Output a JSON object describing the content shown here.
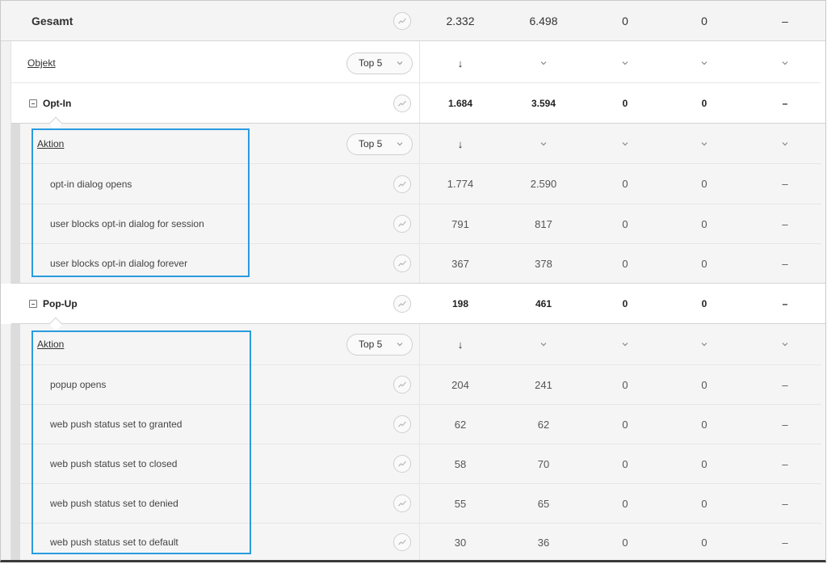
{
  "total": {
    "label": "Gesamt",
    "values": [
      "2.332",
      "6.498",
      "0",
      "0",
      "–"
    ]
  },
  "objekt": {
    "label": "Objekt",
    "top_label": "Top 5",
    "sort_arrow": "↓"
  },
  "groups": [
    {
      "title": "Opt-In",
      "values": [
        "1.684",
        "3.594",
        "0",
        "0",
        "–"
      ],
      "dimension": "Aktion",
      "top_label": "Top 5",
      "rows": [
        {
          "label": "opt-in dialog opens",
          "values": [
            "1.774",
            "2.590",
            "0",
            "0",
            "–"
          ]
        },
        {
          "label": "user blocks opt-in dialog for session",
          "values": [
            "791",
            "817",
            "0",
            "0",
            "–"
          ]
        },
        {
          "label": "user blocks opt-in dialog forever",
          "values": [
            "367",
            "378",
            "0",
            "0",
            "–"
          ]
        }
      ]
    },
    {
      "title": "Pop-Up",
      "values": [
        "198",
        "461",
        "0",
        "0",
        "–"
      ],
      "dimension": "Aktion",
      "top_label": "Top 5",
      "rows": [
        {
          "label": "popup opens",
          "values": [
            "204",
            "241",
            "0",
            "0",
            "–"
          ]
        },
        {
          "label": "web push status set to granted",
          "values": [
            "62",
            "62",
            "0",
            "0",
            "–"
          ]
        },
        {
          "label": "web push status set to closed",
          "values": [
            "58",
            "70",
            "0",
            "0",
            "–"
          ]
        },
        {
          "label": "web push status set to denied",
          "values": [
            "55",
            "65",
            "0",
            "0",
            "–"
          ]
        },
        {
          "label": "web push status set to default",
          "values": [
            "30",
            "36",
            "0",
            "0",
            "–"
          ]
        }
      ]
    }
  ],
  "icons": {
    "trend": "trend-line-icon",
    "chevron": "chevron-down-icon",
    "collapse": "collapse-minus-icon"
  },
  "colors": {
    "highlight": "#2a9be0",
    "gray_bg": "#f5f5f5",
    "header_bg": "#f4f4f4"
  }
}
